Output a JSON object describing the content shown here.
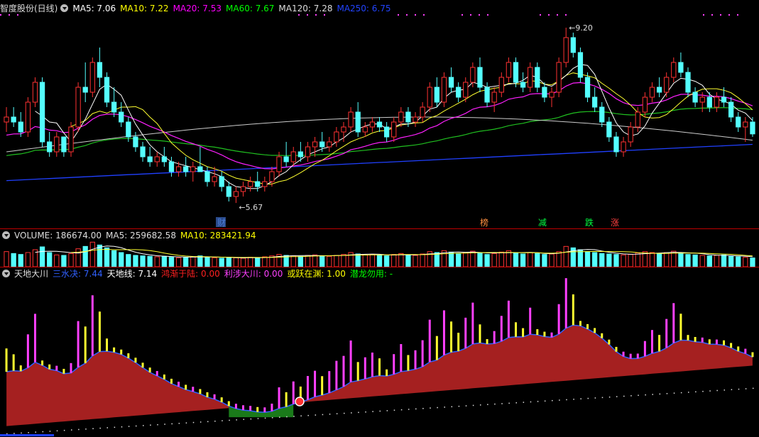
{
  "header": {
    "stock_title": "智度股份(日线)",
    "ma": [
      {
        "label": "MA5: 7.06",
        "color": "#ffffff"
      },
      {
        "label": "MA10: 7.22",
        "color": "#ffff00"
      },
      {
        "label": "MA20: 7.53",
        "color": "#ff00ff"
      },
      {
        "label": "MA60: 7.67",
        "color": "#00ff00"
      },
      {
        "label": "MA120: 7.28",
        "color": "#dddddd"
      },
      {
        "label": "MA250: 6.75",
        "color": "#2244ff"
      }
    ]
  },
  "volume_header": {
    "label": "VOLUME: 186674.00",
    "ma5": "MA5: 259682.58",
    "ma10": "MA10: 283421.94"
  },
  "indicator_header": {
    "name": "天地大川",
    "items": [
      {
        "label": "三水决: 7.44",
        "color": "#3060ff"
      },
      {
        "label": "天地线: 7.14",
        "color": "#ffffff"
      },
      {
        "label": "鸿渐于陆: 0.00",
        "color": "#ff2020"
      },
      {
        "label": "利涉大川: 0.00",
        "color": "#ff40ff"
      },
      {
        "label": "或跃在渊: 1.00",
        "color": "#ffff00"
      },
      {
        "label": "潜龙勿用: -",
        "color": "#00ff00"
      }
    ]
  },
  "annotations": {
    "high": "9.20",
    "low": "5.67",
    "signals": [
      {
        "text": "财",
        "color": "#4a7bd4",
        "bg": "#ffffff"
      },
      {
        "text": "榜",
        "color": "#ff9040",
        "bg": ""
      },
      {
        "text": "减",
        "color": "#00ff40",
        "bg": ""
      },
      {
        "text": "跌",
        "color": "#00ff40",
        "bg": ""
      },
      {
        "text": "涨",
        "color": "#ff4040",
        "bg": ""
      }
    ]
  },
  "chart_data": {
    "type": "candlestick",
    "price_ylim": [
      5.3,
      9.5
    ],
    "candles": [
      [
        7.3,
        7.6,
        7.1,
        7.4
      ],
      [
        7.4,
        7.6,
        7.2,
        7.3
      ],
      [
        7.3,
        7.5,
        7.0,
        7.1
      ],
      [
        7.1,
        7.8,
        7.0,
        7.7
      ],
      [
        7.7,
        8.2,
        7.6,
        8.1
      ],
      [
        8.1,
        8.2,
        6.8,
        6.9
      ],
      [
        6.9,
        7.1,
        6.6,
        6.7
      ],
      [
        6.7,
        7.1,
        6.6,
        7.0
      ],
      [
        7.0,
        7.0,
        6.6,
        6.7
      ],
      [
        6.7,
        7.3,
        6.6,
        7.2
      ],
      [
        7.2,
        8.1,
        7.1,
        8.0
      ],
      [
        8.0,
        8.5,
        7.7,
        7.9
      ],
      [
        7.9,
        8.6,
        7.8,
        8.5
      ],
      [
        8.5,
        8.8,
        8.0,
        8.2
      ],
      [
        8.2,
        8.3,
        7.6,
        7.7
      ],
      [
        7.7,
        8.0,
        7.4,
        7.5
      ],
      [
        7.5,
        7.7,
        7.2,
        7.3
      ],
      [
        7.3,
        7.4,
        6.9,
        7.0
      ],
      [
        7.0,
        7.1,
        6.7,
        6.8
      ],
      [
        6.8,
        6.9,
        6.5,
        6.6
      ],
      [
        6.6,
        6.8,
        6.4,
        6.5
      ],
      [
        6.5,
        6.7,
        6.4,
        6.6
      ],
      [
        6.6,
        6.8,
        6.4,
        6.5
      ],
      [
        6.5,
        6.6,
        6.2,
        6.3
      ],
      [
        6.3,
        6.5,
        6.2,
        6.4
      ],
      [
        6.4,
        6.6,
        6.2,
        6.3
      ],
      [
        6.3,
        6.5,
        6.1,
        6.4
      ],
      [
        6.4,
        6.8,
        6.3,
        6.3
      ],
      [
        6.3,
        6.4,
        6.0,
        6.1
      ],
      [
        6.1,
        6.4,
        6.0,
        6.2
      ],
      [
        6.2,
        6.3,
        5.9,
        6.0
      ],
      [
        6.0,
        6.1,
        5.7,
        5.8
      ],
      [
        5.8,
        6.0,
        5.67,
        5.9
      ],
      [
        5.9,
        6.1,
        5.8,
        6.0
      ],
      [
        6.0,
        6.2,
        5.9,
        6.1
      ],
      [
        6.1,
        6.3,
        5.9,
        6.0
      ],
      [
        6.0,
        6.2,
        5.9,
        6.1
      ],
      [
        6.1,
        6.4,
        6.0,
        6.3
      ],
      [
        6.3,
        6.7,
        6.2,
        6.6
      ],
      [
        6.6,
        6.9,
        6.4,
        6.5
      ],
      [
        6.5,
        6.8,
        6.4,
        6.7
      ],
      [
        6.7,
        6.9,
        6.5,
        6.6
      ],
      [
        6.6,
        6.9,
        6.5,
        6.8
      ],
      [
        6.8,
        7.0,
        6.6,
        6.9
      ],
      [
        6.9,
        7.1,
        6.7,
        6.8
      ],
      [
        6.8,
        7.0,
        6.7,
        6.9
      ],
      [
        6.9,
        7.2,
        6.8,
        7.1
      ],
      [
        7.1,
        7.3,
        6.9,
        7.2
      ],
      [
        7.2,
        7.6,
        7.1,
        7.5
      ],
      [
        7.5,
        7.7,
        7.0,
        7.1
      ],
      [
        7.1,
        7.3,
        7.0,
        7.2
      ],
      [
        7.2,
        7.4,
        7.1,
        7.3
      ],
      [
        7.3,
        7.4,
        7.1,
        7.2
      ],
      [
        7.2,
        7.3,
        6.9,
        7.0
      ],
      [
        7.0,
        7.4,
        6.9,
        7.3
      ],
      [
        7.3,
        7.6,
        7.2,
        7.5
      ],
      [
        7.5,
        7.6,
        7.2,
        7.3
      ],
      [
        7.3,
        7.5,
        7.2,
        7.4
      ],
      [
        7.4,
        7.7,
        7.3,
        7.6
      ],
      [
        7.6,
        8.1,
        7.5,
        8.0
      ],
      [
        8.0,
        8.2,
        7.6,
        7.7
      ],
      [
        7.7,
        8.3,
        7.6,
        8.2
      ],
      [
        8.2,
        8.4,
        7.9,
        8.0
      ],
      [
        8.0,
        8.1,
        7.7,
        7.8
      ],
      [
        7.8,
        8.2,
        7.7,
        8.1
      ],
      [
        8.1,
        8.5,
        8.0,
        8.4
      ],
      [
        8.4,
        8.6,
        7.9,
        8.0
      ],
      [
        8.0,
        8.1,
        7.6,
        7.7
      ],
      [
        7.7,
        8.0,
        7.5,
        7.9
      ],
      [
        7.9,
        8.3,
        7.8,
        8.2
      ],
      [
        8.2,
        8.6,
        8.1,
        8.5
      ],
      [
        8.5,
        8.6,
        8.0,
        8.1
      ],
      [
        8.1,
        8.3,
        7.9,
        8.0
      ],
      [
        8.0,
        8.5,
        7.9,
        8.4
      ],
      [
        8.4,
        8.5,
        7.9,
        8.0
      ],
      [
        8.0,
        8.1,
        7.7,
        7.8
      ],
      [
        7.8,
        8.0,
        7.6,
        7.9
      ],
      [
        7.9,
        8.6,
        7.8,
        8.5
      ],
      [
        8.5,
        9.2,
        8.4,
        9.0
      ],
      [
        9.0,
        9.1,
        8.6,
        8.7
      ],
      [
        8.7,
        8.8,
        8.1,
        8.2
      ],
      [
        8.2,
        8.3,
        7.7,
        7.8
      ],
      [
        7.8,
        8.0,
        7.5,
        7.6
      ],
      [
        7.6,
        7.7,
        7.2,
        7.3
      ],
      [
        7.3,
        7.4,
        6.9,
        7.0
      ],
      [
        7.0,
        7.1,
        6.6,
        6.7
      ],
      [
        6.7,
        7.0,
        6.6,
        6.9
      ],
      [
        6.9,
        7.3,
        6.8,
        7.2
      ],
      [
        7.2,
        7.6,
        7.1,
        7.5
      ],
      [
        7.5,
        7.9,
        7.4,
        7.8
      ],
      [
        7.8,
        8.1,
        7.7,
        8.0
      ],
      [
        8.0,
        8.2,
        7.8,
        7.9
      ],
      [
        7.9,
        8.3,
        7.8,
        8.2
      ],
      [
        8.2,
        8.6,
        8.1,
        8.5
      ],
      [
        8.5,
        8.7,
        8.2,
        8.3
      ],
      [
        8.3,
        8.4,
        7.8,
        7.9
      ],
      [
        7.9,
        8.0,
        7.6,
        7.7
      ],
      [
        7.7,
        7.9,
        7.5,
        7.8
      ],
      [
        7.8,
        7.9,
        7.5,
        7.6
      ],
      [
        7.6,
        7.9,
        7.5,
        7.8
      ],
      [
        7.8,
        8.0,
        7.6,
        7.7
      ],
      [
        7.7,
        7.8,
        7.3,
        7.4
      ],
      [
        7.4,
        7.5,
        7.1,
        7.2
      ],
      [
        7.2,
        7.4,
        6.9,
        7.3
      ],
      [
        7.3,
        7.4,
        7.0,
        7.06
      ]
    ],
    "volume": [
      320,
      280,
      260,
      300,
      360,
      420,
      300,
      250,
      240,
      280,
      380,
      430,
      520,
      460,
      400,
      340,
      300,
      260,
      240,
      230,
      220,
      210,
      220,
      200,
      190,
      200,
      210,
      230,
      200,
      190,
      180,
      200,
      190,
      180,
      200,
      190,
      210,
      230,
      260,
      240,
      230,
      220,
      240,
      250,
      230,
      220,
      240,
      260,
      300,
      270,
      250,
      260,
      240,
      230,
      260,
      280,
      250,
      240,
      270,
      320,
      300,
      340,
      310,
      280,
      300,
      330,
      290,
      260,
      280,
      310,
      340,
      300,
      270,
      300,
      280,
      260,
      270,
      320,
      430,
      400,
      360,
      320,
      300,
      280,
      270,
      260,
      250,
      260,
      290,
      320,
      300,
      280,
      300,
      330,
      300,
      260,
      250,
      240,
      230,
      240,
      250,
      220,
      210,
      200,
      186.674
    ],
    "indicator": {
      "series_names": [
        "三水决",
        "天地线",
        "鸿渐于陆",
        "利涉大川",
        "或跃在渊",
        "潜龙勿用"
      ]
    }
  }
}
